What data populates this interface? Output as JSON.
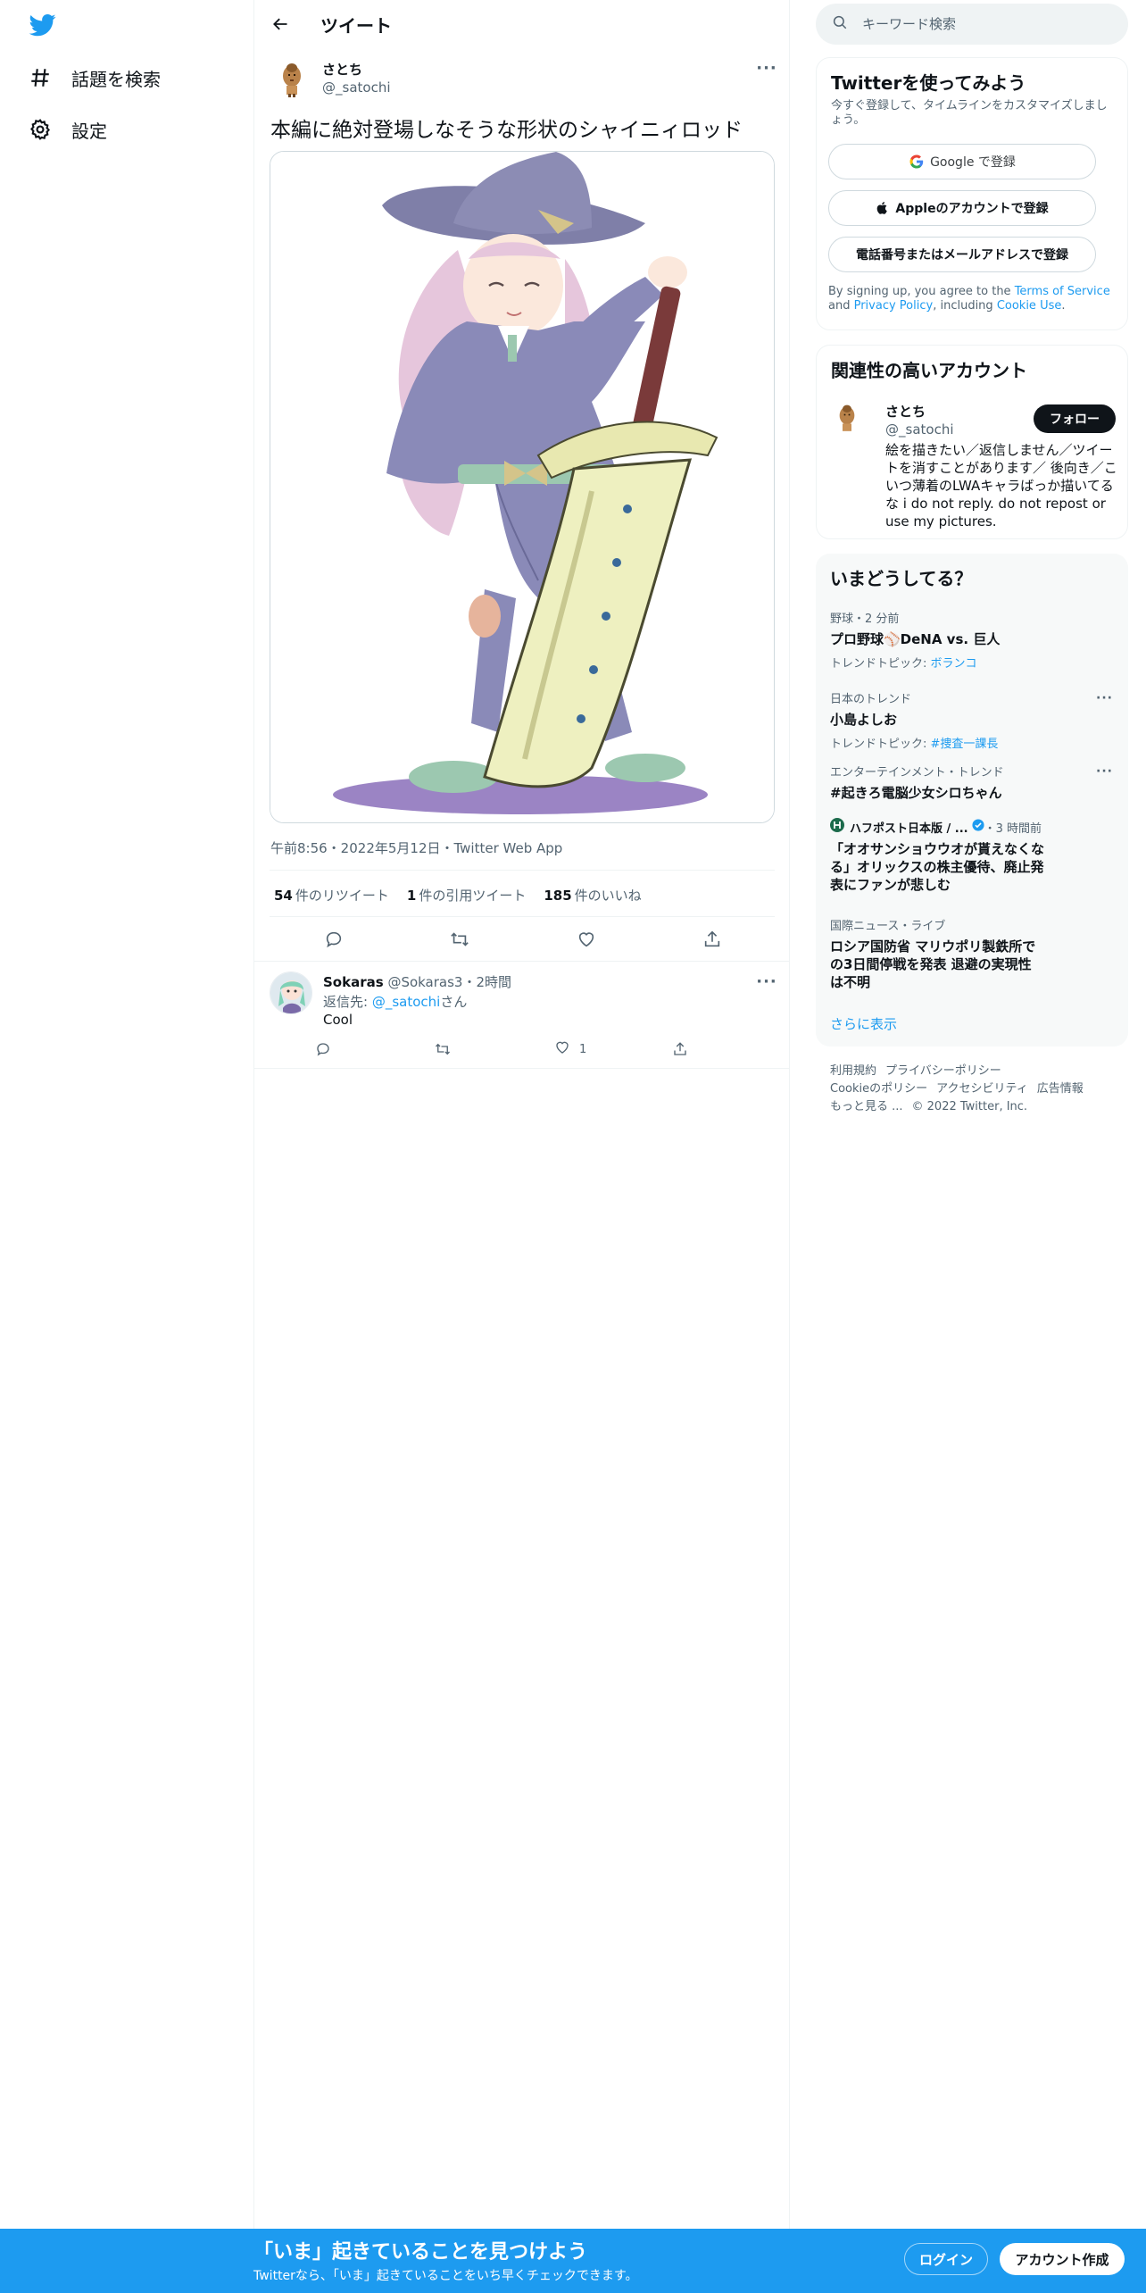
{
  "colors": {
    "brand": "#1d9bf0",
    "text": "#0f1419",
    "muted": "#536471",
    "border": "#eff3f4"
  },
  "sidebar": {
    "logo": "twitter-bird-icon",
    "items": [
      {
        "label": "話題を検索",
        "icon": "hashtag-icon"
      },
      {
        "label": "設定",
        "icon": "gear-icon"
      }
    ]
  },
  "header": {
    "title": "ツイート"
  },
  "tweet": {
    "author_name": "さとち",
    "author_handle": "@_satochi",
    "text": "本編に絶対登場しなそうな形状のシャイニィロッド",
    "meta": "午前8:56・2022年5月12日・Twitter Web App",
    "stats": {
      "retweets_count": "54",
      "retweets_label": "件のリツイート",
      "quotes_count": "1",
      "quotes_label": "件の引用ツイート",
      "likes_count": "185",
      "likes_label": "件のいいね"
    }
  },
  "reply": {
    "name": "Sokaras",
    "handle_time": "@Sokaras3・2時間",
    "reply_to_prefix": "返信先: ",
    "reply_to_handle": "@_satochi",
    "reply_to_suffix": "さん",
    "text": "Cool",
    "like_count": "1"
  },
  "search": {
    "placeholder": "キーワード検索"
  },
  "signup": {
    "title": "Twitterを使ってみよう",
    "subtitle": "今すぐ登録して、タイムラインをカスタマイズしましょう。",
    "google": "Google で登録",
    "apple": "Appleのアカウントで登録",
    "phone": "電話番号またはメールアドレスで登録",
    "terms_prefix": "By signing up, you agree to the ",
    "terms_link": "Terms of Service",
    "terms_and": " and ",
    "privacy_link": "Privacy Policy",
    "terms_including": ", including ",
    "cookie_link": "Cookie Use",
    "terms_end": "."
  },
  "related": {
    "title": "関連性の高いアカウント",
    "name": "さとち",
    "handle": "@_satochi",
    "follow": "フォロー",
    "bio": "絵を描きたい／返信しません／ツイートを消すことがあります／ 後向き／こいつ薄着のLWAキャラばっか描いてるな i do not reply. do not repost or use my pictures."
  },
  "trends": {
    "title": "いまどうしてる？",
    "items": [
      {
        "context": "野球・2 分前",
        "title": "プロ野球⚾DeNA vs. 巨人",
        "topic_label": "トレンドトピック: ",
        "topic": "ボランコ"
      },
      {
        "context": "日本のトレンド",
        "title": "小島よしお",
        "topic_label": "トレンドトピック: ",
        "topic": "#捜査一課長"
      },
      {
        "context": "エンターテインメント・トレンド",
        "title": "#起きろ電脳少女シロちゃん"
      },
      {
        "source": "ハフポスト日本版 / ...",
        "time": "・3 時間前",
        "title": "「オオサンショウウオが貰えなくなる」オリックスの株主優待、廃止発表にファンが悲しむ"
      },
      {
        "context": "国際ニュース・ライブ",
        "title": "ロシア国防省 マリウポリ製鉄所での3日間停戦を発表 退避の実現性は不明"
      }
    ],
    "show_more": "さらに表示"
  },
  "footer": {
    "terms": "利用規約",
    "privacy": "プライバシーポリシー",
    "cookie": "Cookieのポリシー",
    "accessibility": "アクセシビリティ",
    "ads": "広告情報",
    "more": "もっと見る ...",
    "copyright": "© 2022 Twitter, Inc."
  },
  "banner": {
    "title": "「いま」起きていることを見つけよう",
    "subtitle": "Twitterなら、「いま」起きていることをいち早くチェックできます。",
    "login": "ログイン",
    "signup": "アカウント作成"
  }
}
